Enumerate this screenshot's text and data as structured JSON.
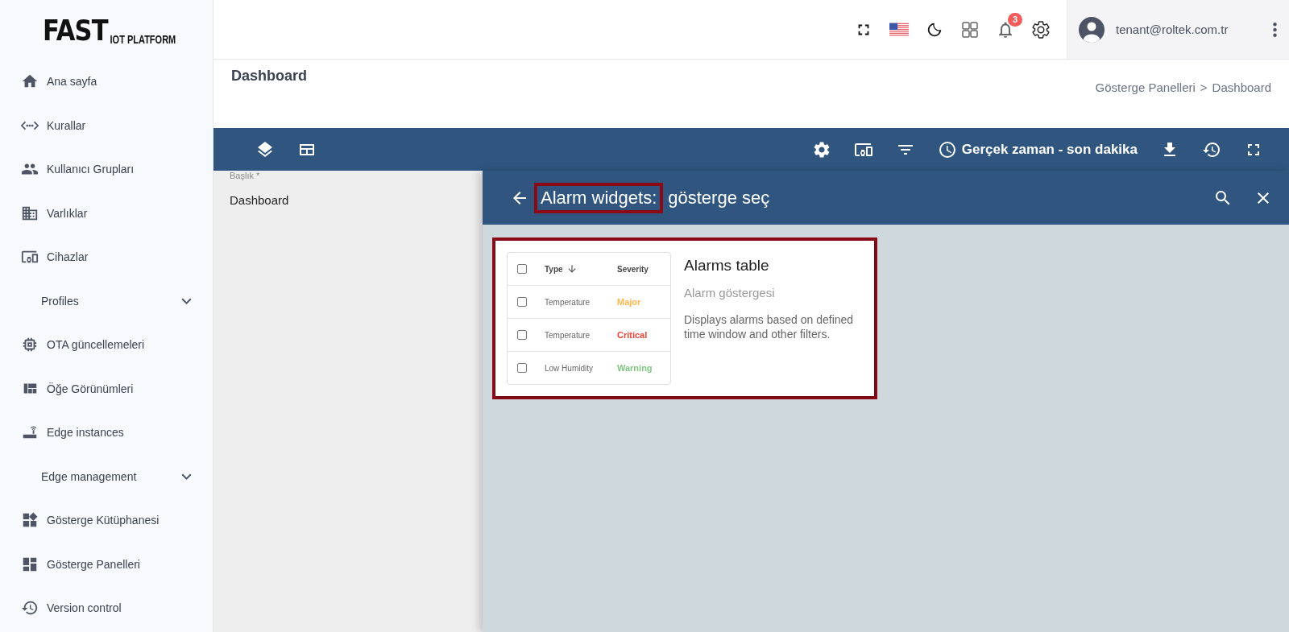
{
  "logo": {
    "primary": "FAST",
    "secondary": "IOT PLATFORM"
  },
  "sidebar": {
    "items": [
      {
        "kind": "link",
        "label": "Ana sayfa"
      },
      {
        "kind": "link",
        "label": "Kurallar"
      },
      {
        "kind": "link",
        "label": "Kullanıcı Grupları"
      },
      {
        "kind": "link",
        "label": "Varlıklar"
      },
      {
        "kind": "link",
        "label": "Cihazlar"
      },
      {
        "kind": "group",
        "label": "Profiles",
        "expanded": false
      },
      {
        "kind": "link",
        "label": "OTA güncellemeleri"
      },
      {
        "kind": "link",
        "label": "Öğe Görünümleri"
      },
      {
        "kind": "link",
        "label": "Edge instances"
      },
      {
        "kind": "group",
        "label": "Edge management",
        "expanded": false
      },
      {
        "kind": "link",
        "label": "Gösterge Kütüphanesi"
      },
      {
        "kind": "link",
        "label": "Gösterge Panelleri"
      },
      {
        "kind": "link",
        "label": "Version control"
      }
    ]
  },
  "topbar": {
    "notification_count": "3",
    "user_email": "tenant@roltek.com.tr"
  },
  "page": {
    "title": "Dashboard",
    "breadcrumb": [
      "Gösterge Panelleri",
      "Dashboard"
    ],
    "separator": ">"
  },
  "toolbar": {
    "timewindow": "Gerçek zaman - son dakika"
  },
  "form": {
    "label": "Başlık *",
    "value": "Dashboard"
  },
  "dialog": {
    "title_prefix": "Alarm widgets:",
    "title_rest": "gösterge seç",
    "title_highlighted": true,
    "widgets": [
      {
        "title": "Alarms table",
        "subtitle": "Alarm göstergesi",
        "description": "Displays alarms based on defined time window and other filters.",
        "highlighted": true,
        "preview": {
          "columns": [
            "Type",
            "Severity"
          ],
          "header_checked": false,
          "rows": [
            {
              "type": "Temperature",
              "severity": "Major",
              "color": "#ffb74d",
              "checked": false
            },
            {
              "type": "Temperature",
              "severity": "Critical",
              "color": "#f44336",
              "checked": false
            },
            {
              "type": "Low Humidity",
              "severity": "Warning",
              "color": "#81c784",
              "checked": false
            }
          ]
        }
      }
    ]
  }
}
